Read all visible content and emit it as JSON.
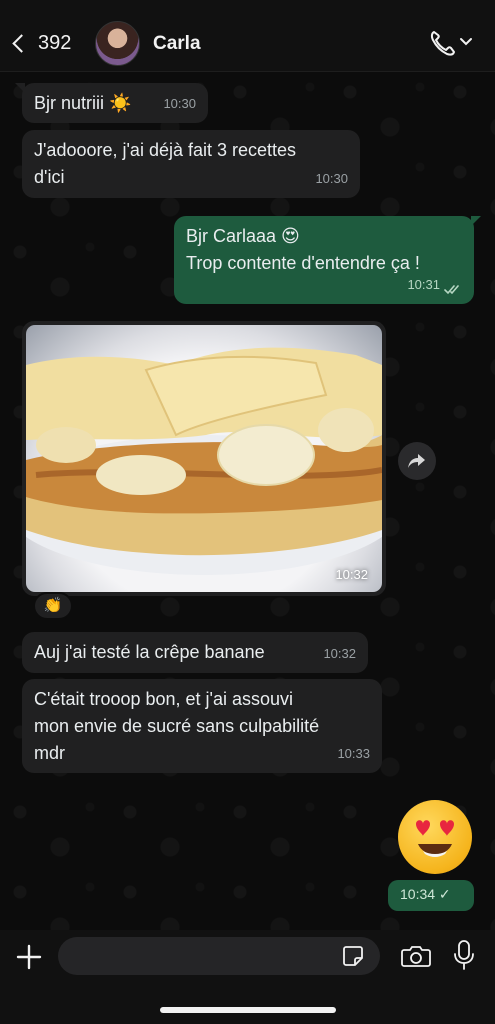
{
  "header": {
    "unread_count": "392",
    "contact_name": "Carla"
  },
  "messages": [
    {
      "text": "Bjr nutriii ☀️",
      "time": "10:30"
    },
    {
      "lines": [
        "J'adooore, j'ai déjà fait 3 recettes",
        "d'ici"
      ],
      "time": "10:30"
    },
    {
      "lines": [
        "Bjr Carlaaa 😍",
        "Trop contente d'entendre ça !"
      ],
      "time": "10:31"
    },
    {
      "photo_time": "10:32",
      "reaction": "👏"
    },
    {
      "text": "Auj j'ai testé la crêpe banane",
      "time": "10:32"
    },
    {
      "lines": [
        "C'était trooop bon, et j'ai assouvi",
        "mon envie de sucré sans culpabilité",
        "mdr"
      ],
      "time": "10:33"
    },
    {
      "emoji": "😍",
      "time": "10:34 ✓"
    }
  ],
  "composer": {
    "placeholder": ""
  },
  "colors": {
    "outgoing_bubble": "#1e5b3e",
    "incoming_bubble": "#202021",
    "background": "#0c0c0c"
  }
}
